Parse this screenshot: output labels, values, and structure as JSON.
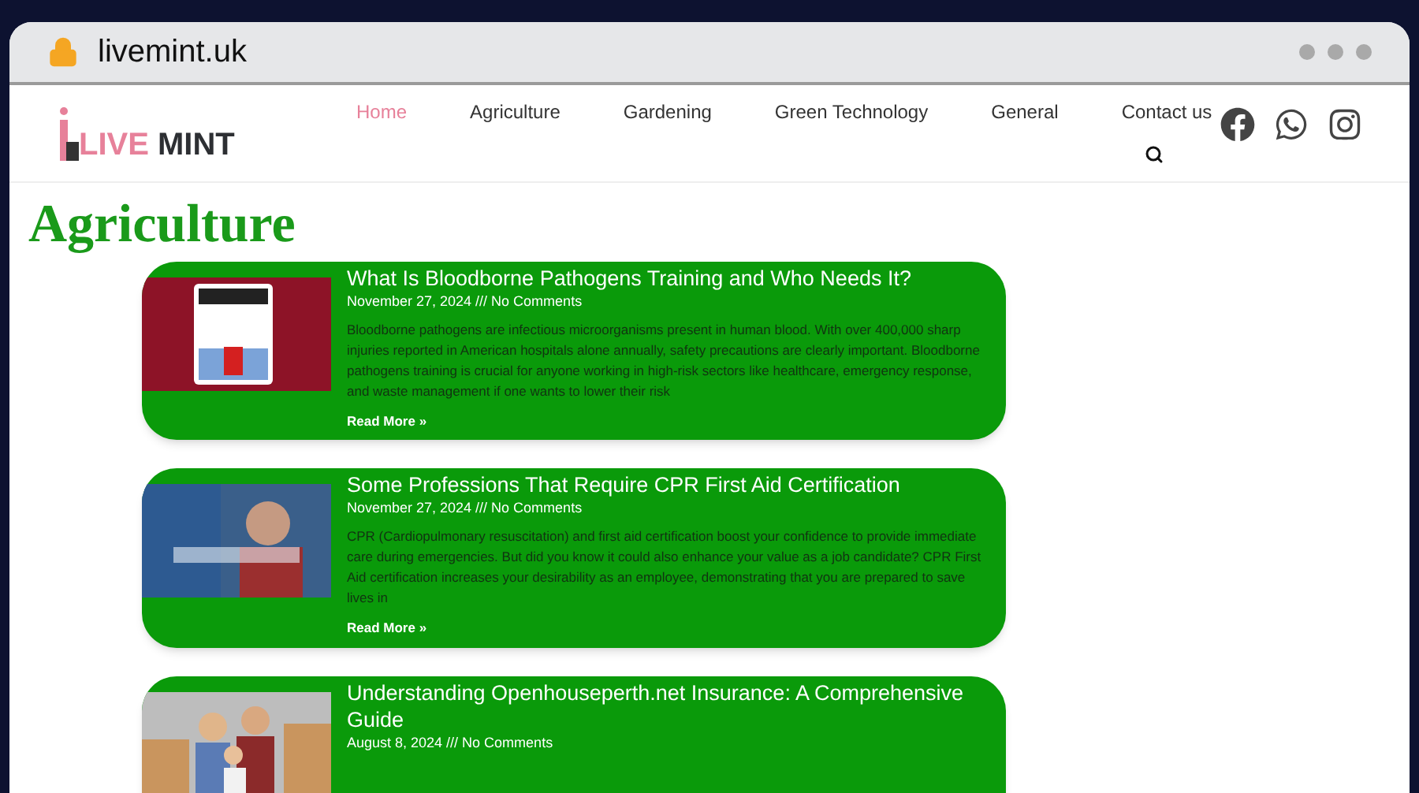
{
  "browser": {
    "address": "livemint.uk"
  },
  "site": {
    "logo_a": "LIVE",
    "logo_b": "MINT",
    "nav": [
      {
        "label": "Home",
        "selected": true
      },
      {
        "label": "Agriculture",
        "selected": false
      },
      {
        "label": "Gardening",
        "selected": false
      },
      {
        "label": "Green Technology",
        "selected": false
      },
      {
        "label": "General",
        "selected": false
      },
      {
        "label": "Contact us",
        "selected": false
      }
    ]
  },
  "heading": "Agriculture",
  "posts": [
    {
      "title": "What Is Bloodborne Pathogens Training and Who Needs It?",
      "meta": "November 27, 2024 /// No Comments",
      "excerpt": "Bloodborne pathogens are infectious microorganisms present in human blood. With over 400,000 sharp injuries reported in American hospitals alone annually, safety precautions are clearly important. Bloodborne pathogens training is crucial for anyone working in high-risk sectors like healthcare, emergency response, and waste management if one wants to lower their risk",
      "more": "Read More »"
    },
    {
      "title": "Some Professions That Require CPR First Aid Certification",
      "meta": "November 27, 2024 /// No Comments",
      "excerpt": "CPR (Cardiopulmonary resuscitation) and first aid certification boost your confidence to provide immediate care during emergencies. But did you know it could also enhance your value as a job candidate? CPR First Aid certification increases your desirability as an employee, demonstrating that you are prepared to save lives in",
      "more": "Read More »"
    },
    {
      "title": "Understanding Openhouseperth.net Insurance: A Comprehensive Guide",
      "meta": "August 8, 2024 /// No Comments"
    }
  ]
}
